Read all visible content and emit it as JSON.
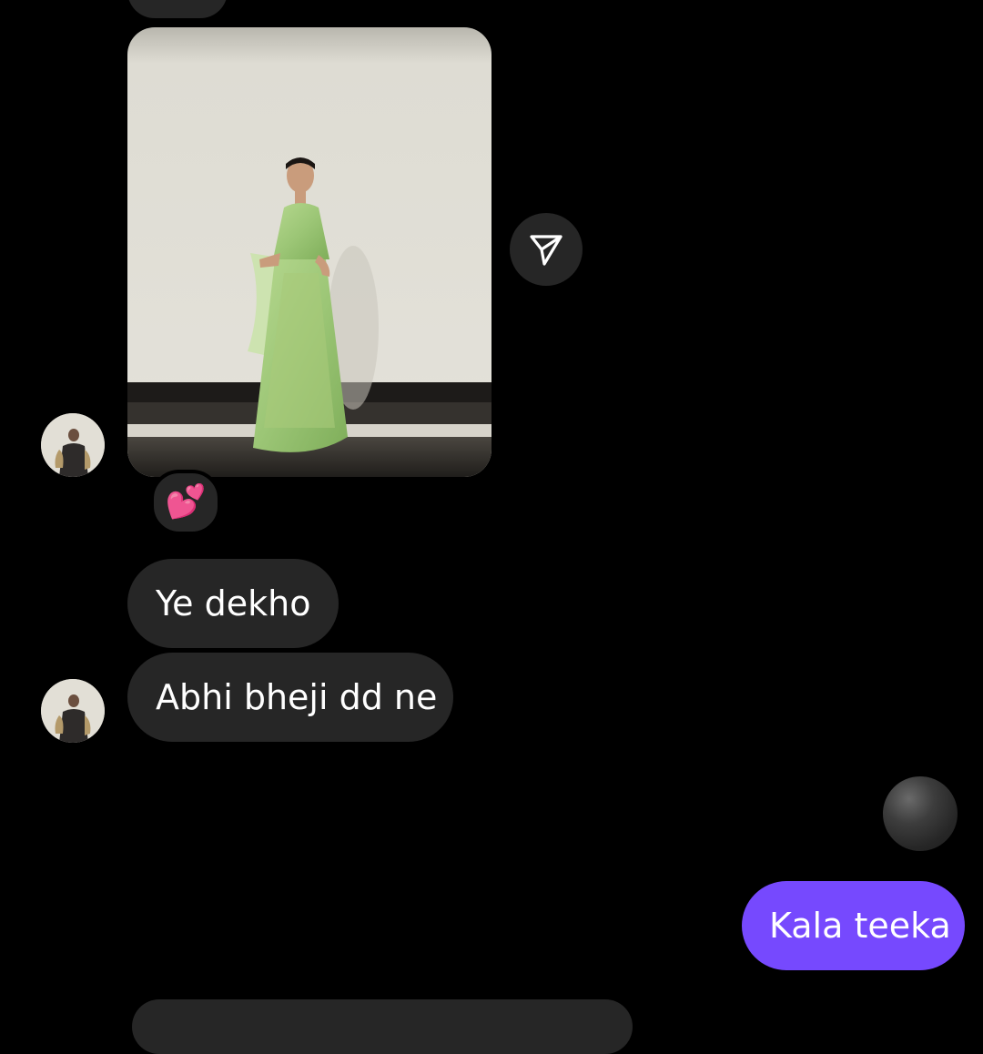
{
  "conversation": {
    "messages": [
      {
        "text": "Ye dekho",
        "direction": "incoming"
      },
      {
        "text": "Abhi bheji dd ne",
        "direction": "incoming"
      },
      {
        "text": "Kala teeka",
        "direction": "outgoing"
      }
    ],
    "reaction": {
      "emoji": "💕"
    }
  },
  "icons": {
    "share": "paper-plane-icon",
    "avatar": "contact-avatar",
    "typing": "typing-indicator"
  },
  "colors": {
    "background": "#000000",
    "incoming_bubble": "#262626",
    "outgoing_bubble": "#7649fe",
    "text": "#ffffff"
  }
}
